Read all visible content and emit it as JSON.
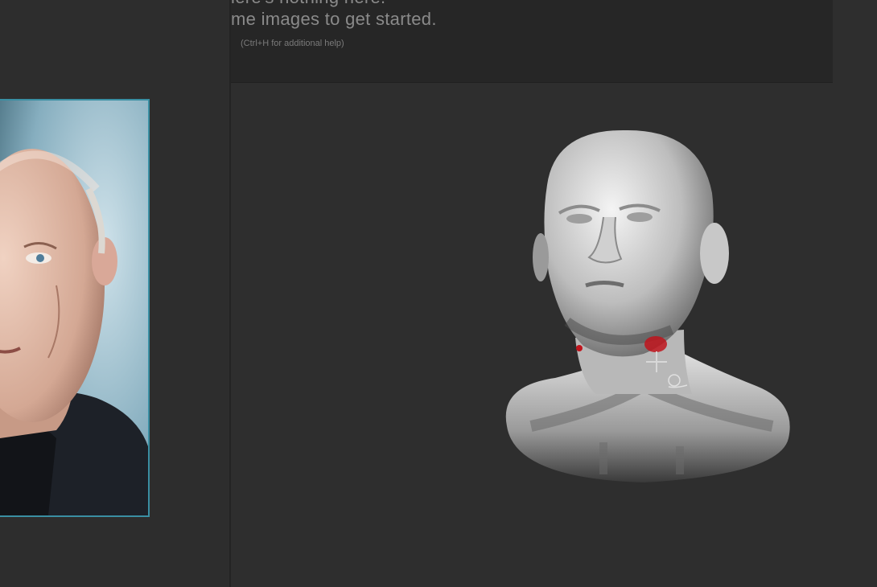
{
  "help_overlay": {
    "line_1": "iere's nothing here.",
    "line_2": "me images to get started.",
    "hint": "(Ctrl+H for additional help)"
  },
  "reference_panel": {
    "image": "reference-portrait",
    "frame_color": "#3a8fa3"
  },
  "viewport": {
    "model": "sculpted-head-bust",
    "paint_color": "#c0141c",
    "cursor": "crosshair-brush-icon"
  }
}
